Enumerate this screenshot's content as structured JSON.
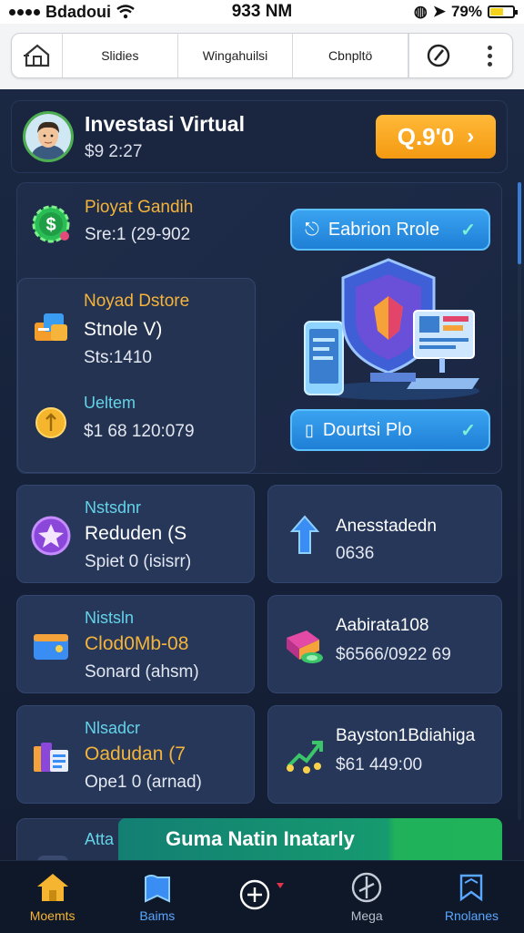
{
  "status_bar": {
    "carrier": "Bdadoui",
    "time": "933 NM",
    "battery": "79%"
  },
  "top_nav": {
    "tabs": [
      {
        "label": "Slidies"
      },
      {
        "label": "Wingahuilsi"
      },
      {
        "label": "Cbnpltö"
      }
    ]
  },
  "profile": {
    "name": "Investasi Virtual",
    "subtitle": "$9 2:27",
    "balance_button": "Q.9'0"
  },
  "main_panel": {
    "card1": {
      "label": "Pioyat Gandih",
      "value": "Sre:1 (29-902"
    },
    "card2": {
      "label": "Noyad Dstore",
      "title": "Stnole V)",
      "value": "Sts:1410",
      "label2": "Ueltem",
      "value2": "$1 68 120:079"
    },
    "button_top": "Eabrion Rrole",
    "button_bottom": "Dourtsi Plo"
  },
  "grid": [
    {
      "label": "Nstsdnr",
      "title": "Reduden (S",
      "value": "Spiet 0 (isisrr)",
      "title_color": "#ffffff"
    },
    {
      "label": "",
      "title": "Anesstadedn",
      "value": "0636",
      "title_color": "#ffffff"
    },
    {
      "label": "Nistsln",
      "title": "Clod0Mb-08",
      "value": "Sonard (ahsm)",
      "title_color": "#f4b43b"
    },
    {
      "label": "",
      "title": "Aabirata108",
      "value": "$6566/0922 69",
      "title_color": "#ffffff"
    },
    {
      "label": "Nlsadcr",
      "title": "Oadudan (7",
      "value": "Ope1 0 (arnad)",
      "title_color": "#f4b43b"
    },
    {
      "label": "",
      "title": "Bayston1Bdiahiga",
      "value": "$61 449:00",
      "title_color": "#ffffff"
    }
  ],
  "partial_card_label": "Atta",
  "banner": "Guma Natin Inatarly",
  "tab_bar": [
    {
      "label": "Moemts"
    },
    {
      "label": "Baims"
    },
    {
      "label": ""
    },
    {
      "label": "Mega"
    },
    {
      "label": "Rnolanes"
    }
  ],
  "colors": {
    "accent_orange": "#f4a21f",
    "accent_blue": "#2f93e8",
    "accent_green": "#1fa866",
    "background": "#16223a"
  }
}
